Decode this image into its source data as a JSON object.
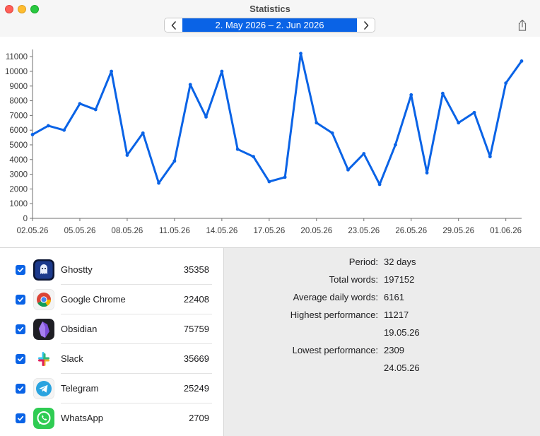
{
  "window": {
    "title": "Statistics",
    "date_range": "2. May 2026 – 2. Jun 2026"
  },
  "chart_data": {
    "type": "line",
    "x": [
      "02.05.26",
      "03.05.26",
      "04.05.26",
      "05.05.26",
      "06.05.26",
      "07.05.26",
      "08.05.26",
      "09.05.26",
      "10.05.26",
      "11.05.26",
      "12.05.26",
      "13.05.26",
      "14.05.26",
      "15.05.26",
      "16.05.26",
      "17.05.26",
      "18.05.26",
      "19.05.26",
      "20.05.26",
      "21.05.26",
      "22.05.26",
      "23.05.26",
      "24.05.26",
      "25.05.26",
      "26.05.26",
      "27.05.26",
      "28.05.26",
      "29.05.26",
      "30.05.26",
      "31.05.26",
      "01.06.26",
      "02.06.26"
    ],
    "values": [
      5700,
      6300,
      6000,
      7800,
      7400,
      10000,
      4300,
      5800,
      2400,
      3900,
      9100,
      6900,
      10000,
      4700,
      4200,
      2500,
      2800,
      11217,
      6500,
      5800,
      3300,
      4400,
      2309,
      5000,
      8400,
      3100,
      8500,
      6500,
      7200,
      4200,
      9200,
      10700
    ],
    "xticks": [
      "02.05.26",
      "05.05.26",
      "08.05.26",
      "11.05.26",
      "14.05.26",
      "17.05.26",
      "20.05.26",
      "23.05.26",
      "26.05.26",
      "29.05.26",
      "01.06.26"
    ],
    "yticks": [
      0,
      1000,
      2000,
      3000,
      4000,
      5000,
      6000,
      7000,
      8000,
      9000,
      10000,
      11000
    ],
    "ylim": [
      0,
      11200
    ],
    "color": "#0a63e6",
    "grid": false
  },
  "apps": [
    {
      "name": "Ghostty",
      "count": "35358",
      "checked": true,
      "icon": "ghostty-icon"
    },
    {
      "name": "Google Chrome",
      "count": "22408",
      "checked": true,
      "icon": "chrome-icon"
    },
    {
      "name": "Obsidian",
      "count": "75759",
      "checked": true,
      "icon": "obsidian-icon"
    },
    {
      "name": "Slack",
      "count": "35669",
      "checked": true,
      "icon": "slack-icon"
    },
    {
      "name": "Telegram",
      "count": "25249",
      "checked": true,
      "icon": "telegram-icon"
    },
    {
      "name": "WhatsApp",
      "count": "2709",
      "checked": true,
      "icon": "whatsapp-icon"
    }
  ],
  "stats": {
    "period_label": "Period:",
    "period_value": "32 days",
    "total_label": "Total words:",
    "total_value": "197152",
    "avg_label": "Average daily words:",
    "avg_value": "6161",
    "high_label": "Highest performance:",
    "high_value": "11217",
    "high_date": "19.05.26",
    "low_label": "Lowest performance:",
    "low_value": "2309",
    "low_date": "24.05.26"
  },
  "colors": {
    "accent": "#0a63e6"
  }
}
